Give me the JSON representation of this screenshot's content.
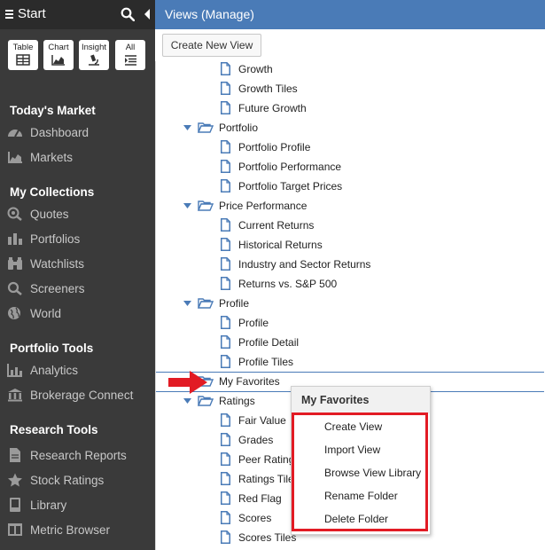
{
  "sidebar": {
    "title": "Start",
    "quick_buttons": [
      {
        "label": "Table",
        "icon": "table-icon"
      },
      {
        "label": "Chart",
        "icon": "chart-icon"
      },
      {
        "label": "Insight",
        "icon": "insight-icon"
      },
      {
        "label": "All",
        "icon": "list-icon"
      }
    ],
    "sections": [
      {
        "title": "Today's Market",
        "items": [
          {
            "label": "Dashboard",
            "icon": "dashboard-icon"
          },
          {
            "label": "Markets",
            "icon": "markets-icon"
          }
        ]
      },
      {
        "title": "My Collections",
        "items": [
          {
            "label": "Quotes",
            "icon": "quotes-icon"
          },
          {
            "label": "Portfolios",
            "icon": "portfolios-icon"
          },
          {
            "label": "Watchlists",
            "icon": "binoculars-icon"
          },
          {
            "label": "Screeners",
            "icon": "search-icon"
          },
          {
            "label": "World",
            "icon": "globe-icon"
          }
        ]
      },
      {
        "title": "Portfolio Tools",
        "items": [
          {
            "label": "Analytics",
            "icon": "analytics-icon"
          },
          {
            "label": "Brokerage Connect",
            "icon": "bank-icon"
          }
        ]
      },
      {
        "title": "Research Tools",
        "items": [
          {
            "label": "Research Reports",
            "icon": "document-icon"
          },
          {
            "label": "Stock Ratings",
            "icon": "star-icon"
          },
          {
            "label": "Library",
            "icon": "library-icon"
          },
          {
            "label": "Metric Browser",
            "icon": "browser-icon"
          }
        ]
      }
    ]
  },
  "main": {
    "title": "Views (Manage)",
    "create_button": "Create New View",
    "tree": [
      {
        "type": "file",
        "label": "Growth"
      },
      {
        "type": "file",
        "label": "Growth Tiles"
      },
      {
        "type": "file",
        "label": "Future Growth"
      },
      {
        "type": "folder",
        "label": "Portfolio"
      },
      {
        "type": "file",
        "label": "Portfolio Profile"
      },
      {
        "type": "file",
        "label": "Portfolio Performance"
      },
      {
        "type": "file",
        "label": "Portfolio Target Prices"
      },
      {
        "type": "folder",
        "label": "Price Performance"
      },
      {
        "type": "file",
        "label": "Current Returns"
      },
      {
        "type": "file",
        "label": "Historical Returns"
      },
      {
        "type": "file",
        "label": "Industry and Sector Returns"
      },
      {
        "type": "file",
        "label": "Returns vs. S&P 500"
      },
      {
        "type": "folder",
        "label": "Profile"
      },
      {
        "type": "file",
        "label": "Profile"
      },
      {
        "type": "file",
        "label": "Profile Detail"
      },
      {
        "type": "file",
        "label": "Profile Tiles"
      },
      {
        "type": "folder-collapsed",
        "label": "My Favorites"
      },
      {
        "type": "folder",
        "label": "Ratings"
      },
      {
        "type": "file",
        "label": "Fair Value"
      },
      {
        "type": "file",
        "label": "Grades"
      },
      {
        "type": "file",
        "label": "Peer Rating"
      },
      {
        "type": "file",
        "label": "Ratings Tile"
      },
      {
        "type": "file",
        "label": "Red Flag"
      },
      {
        "type": "file",
        "label": "Scores"
      },
      {
        "type": "file",
        "label": "Scores Tiles"
      }
    ]
  },
  "context_menu": {
    "title": "My Favorites",
    "items": [
      "Create View",
      "Import View",
      "Browse View Library",
      "Rename Folder",
      "Delete Folder"
    ]
  },
  "colors": {
    "header_blue": "#4a7bb7",
    "sidebar_bg": "#3a3a3a",
    "highlight_red": "#e21b24"
  }
}
